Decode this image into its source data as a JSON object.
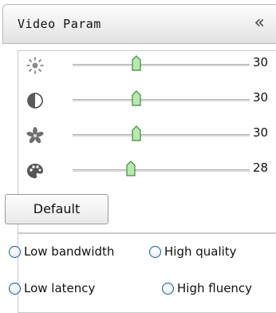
{
  "header": {
    "title": "Video Param",
    "collapse_glyph": "«"
  },
  "sliders": [
    {
      "icon": "brightness-icon",
      "value": "30",
      "level": 0.35
    },
    {
      "icon": "contrast-icon",
      "value": "30",
      "level": 0.35
    },
    {
      "icon": "saturation-icon",
      "value": "30",
      "level": 0.35
    },
    {
      "icon": "hue-icon",
      "value": "28",
      "level": 0.32
    }
  ],
  "default_button": {
    "label": "Default"
  },
  "modes": [
    {
      "label": "Low bandwidth",
      "selected": false
    },
    {
      "label": "High quality",
      "selected": false
    },
    {
      "label": "Low latency",
      "selected": false
    },
    {
      "label": "High fluency",
      "selected": false
    }
  ],
  "colors": {
    "thumb_fill": "#b9e7b0",
    "thumb_border": "#3c8c3c",
    "radio_border": "#1d5a9a"
  }
}
